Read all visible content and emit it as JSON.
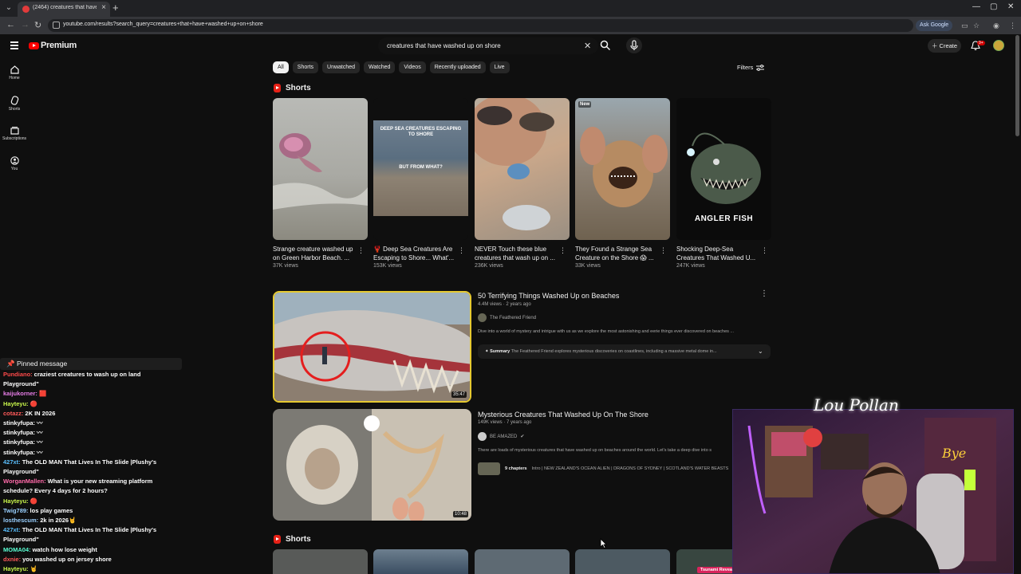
{
  "browser": {
    "tab_title": "(2464) creatures that have wash",
    "url": "youtube.com/results?search_query=creatures+that+have+washed+up+on+shore",
    "ask_google": "Ask Google"
  },
  "header": {
    "logo_text": "Premium",
    "search_value": "creatures that have washed up on shore",
    "create_label": "Create",
    "notif_count": "9+"
  },
  "sidebar": {
    "items": [
      {
        "label": "Home",
        "icon": "home-icon"
      },
      {
        "label": "Shorts",
        "icon": "shorts-icon"
      },
      {
        "label": "Subscriptions",
        "icon": "subscriptions-icon"
      },
      {
        "label": "You",
        "icon": "you-icon"
      }
    ]
  },
  "chips": [
    "All",
    "Shorts",
    "Unwatched",
    "Watched",
    "Videos",
    "Recently uploaded",
    "Live"
  ],
  "filters_label": "Filters",
  "shorts_shelf": {
    "title": "Shorts",
    "items": [
      {
        "title": "Strange creature washed up on Green Harbor Beach. ...",
        "views": "37K views"
      },
      {
        "title": "🦞 Deep Sea Creatures Are Escaping to Shore... What'...",
        "views": "153K views",
        "overlay_top": "DEEP SEA CREATURES ESCAPING TO SHORE",
        "overlay_bottom": "BUT FROM WHAT?"
      },
      {
        "title": "NEVER Touch these blue creatures that wash up on ...",
        "views": "236K views"
      },
      {
        "title": "They Found a Strange Sea Creature on the Shore 😱 ...",
        "views": "33K views",
        "badge": "New"
      },
      {
        "title": "Shocking Deep-Sea Creatures That Washed U...",
        "views": "247K views",
        "overlay": "ANGLER FISH"
      }
    ]
  },
  "videos": [
    {
      "title": "50 Terrifying Things Washed Up on Beaches",
      "meta": "4.4M views · 2 years ago",
      "channel": "The Feathered Friend",
      "description": "Dive into a world of mystery and intrigue with us as we explore the most astonishing and eerie things ever discovered on beaches ...",
      "summary_label": "Summary",
      "summary": "The Feathered Friend explores mysterious discoveries on coastlines, including a massive metal dome in...",
      "duration": "35:47"
    },
    {
      "title": "Mysterious Creatures That Washed Up On The Shore",
      "meta": "149K views · 7 years ago",
      "channel": "BE AMAZED",
      "description": "There are loads of mysterious creatures that have washed up on beaches around the world. Let's take a deep dive into s",
      "chapters_label": "9 chapters",
      "chapters": "Intro | NEW ZEALAND'S OCEAN ALIEN | DRAGONS OF SYDNEY | SCOTLAND'S WATER BEASTS",
      "duration": "10:48"
    }
  ],
  "second_shelf_title": "Shorts",
  "second_shelf_label": "Tsunami Reveals",
  "chat": {
    "pinned_label": "Pinned message",
    "messages": [
      {
        "user": "Pundiano:",
        "text": "craziest creatures to wash up on land",
        "color": "#ff4a4a"
      },
      {
        "user": "",
        "text": "Playground\"",
        "color": "#ffffff"
      },
      {
        "user": "kaijukorner:",
        "text": "🟥",
        "color": "#e87ee8"
      },
      {
        "user": "Hayteyu:",
        "text": "🔴",
        "color": "#c8f54b"
      },
      {
        "user": "cotazz:",
        "text": "2K IN 2026",
        "color": "#ff5a5a"
      },
      {
        "user": "stinkyfupa:",
        "text": "〰",
        "color": "#ffffff"
      },
      {
        "user": "stinkyfupa:",
        "text": "〰",
        "color": "#ffffff"
      },
      {
        "user": "stinkyfupa:",
        "text": "〰",
        "color": "#ffffff"
      },
      {
        "user": "stinkyfupa:",
        "text": "〰",
        "color": "#ffffff"
      },
      {
        "user": "427xt:",
        "text": "The OLD MAN That Lives In The Slide |Plushy's",
        "color": "#5bc0ff"
      },
      {
        "user": "",
        "text": "Playground\"",
        "color": "#ffffff"
      },
      {
        "user": "WorganMallen:",
        "text": "What is your new streaming platform",
        "color": "#ff6aa9"
      },
      {
        "user": "",
        "text": "schedule? Every 4 days for 2 hours?",
        "color": "#ffffff"
      },
      {
        "user": "Hayteyu:",
        "text": "🔴",
        "color": "#c8f54b"
      },
      {
        "user": "Twig789:",
        "text": "los play games",
        "color": "#9ad0ff"
      },
      {
        "user": "losthescum:",
        "text": "2k in 2026🤘",
        "color": "#9ad0ff"
      },
      {
        "user": "427xt:",
        "text": "The OLD MAN That Lives In The Slide |Plushy's",
        "color": "#5bc0ff"
      },
      {
        "user": "",
        "text": "Playground\"",
        "color": "#ffffff"
      },
      {
        "user": "MOMA04:",
        "text": "watch how lose weight",
        "color": "#5bffd4"
      },
      {
        "user": "dxnie:",
        "text": "you washed up on jersey shore",
        "color": "#ff5a5a"
      },
      {
        "user": "Hayteyu:",
        "text": "🤘",
        "color": "#c8f54b"
      }
    ]
  },
  "webcam_signature": "Lou Pollan"
}
